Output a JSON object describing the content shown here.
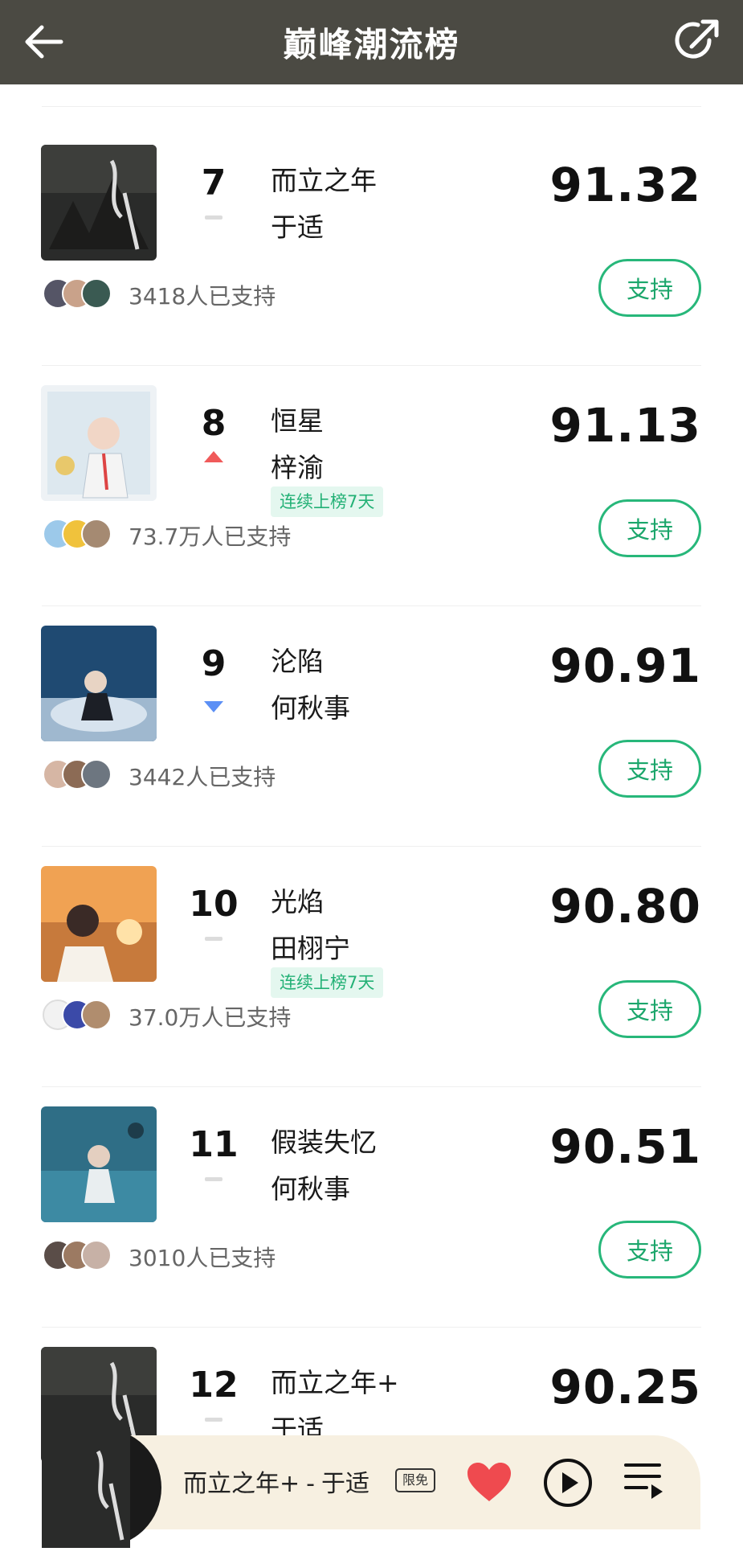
{
  "header": {
    "title": "巅峰潮流榜"
  },
  "items": [
    {
      "rank": "7",
      "trend": "flat",
      "song": "而立之年",
      "artist": "于适",
      "streak": "",
      "score": "91.32",
      "supporters": "3418人已支持",
      "support_label": "支持"
    },
    {
      "rank": "8",
      "trend": "up",
      "song": "恒星",
      "artist": "梓渝",
      "streak": "连续上榜7天",
      "score": "91.13",
      "supporters": "73.7万人已支持",
      "support_label": "支持"
    },
    {
      "rank": "9",
      "trend": "down",
      "song": "沦陷",
      "artist": "何秋事",
      "streak": "",
      "score": "90.91",
      "supporters": "3442人已支持",
      "support_label": "支持"
    },
    {
      "rank": "10",
      "trend": "flat",
      "song": "光焰",
      "artist": "田栩宁",
      "streak": "连续上榜7天",
      "score": "90.80",
      "supporters": "37.0万人已支持",
      "support_label": "支持"
    },
    {
      "rank": "11",
      "trend": "flat",
      "song": "假装失忆",
      "artist": "何秋事",
      "streak": "",
      "score": "90.51",
      "supporters": "3010人已支持",
      "support_label": "支持"
    },
    {
      "rank": "12",
      "trend": "flat",
      "song": "而立之年+",
      "artist": "于适",
      "streak": "",
      "score": "90.25",
      "supporters": "",
      "support_label": ""
    }
  ],
  "player": {
    "song": "而立之年+",
    "dash": "-",
    "artist": "于适",
    "badge": "限免"
  },
  "colors": {
    "header": "#4b4a43",
    "accent": "#27b77a",
    "up": "#f05a5a",
    "down": "#5b8ff5"
  }
}
